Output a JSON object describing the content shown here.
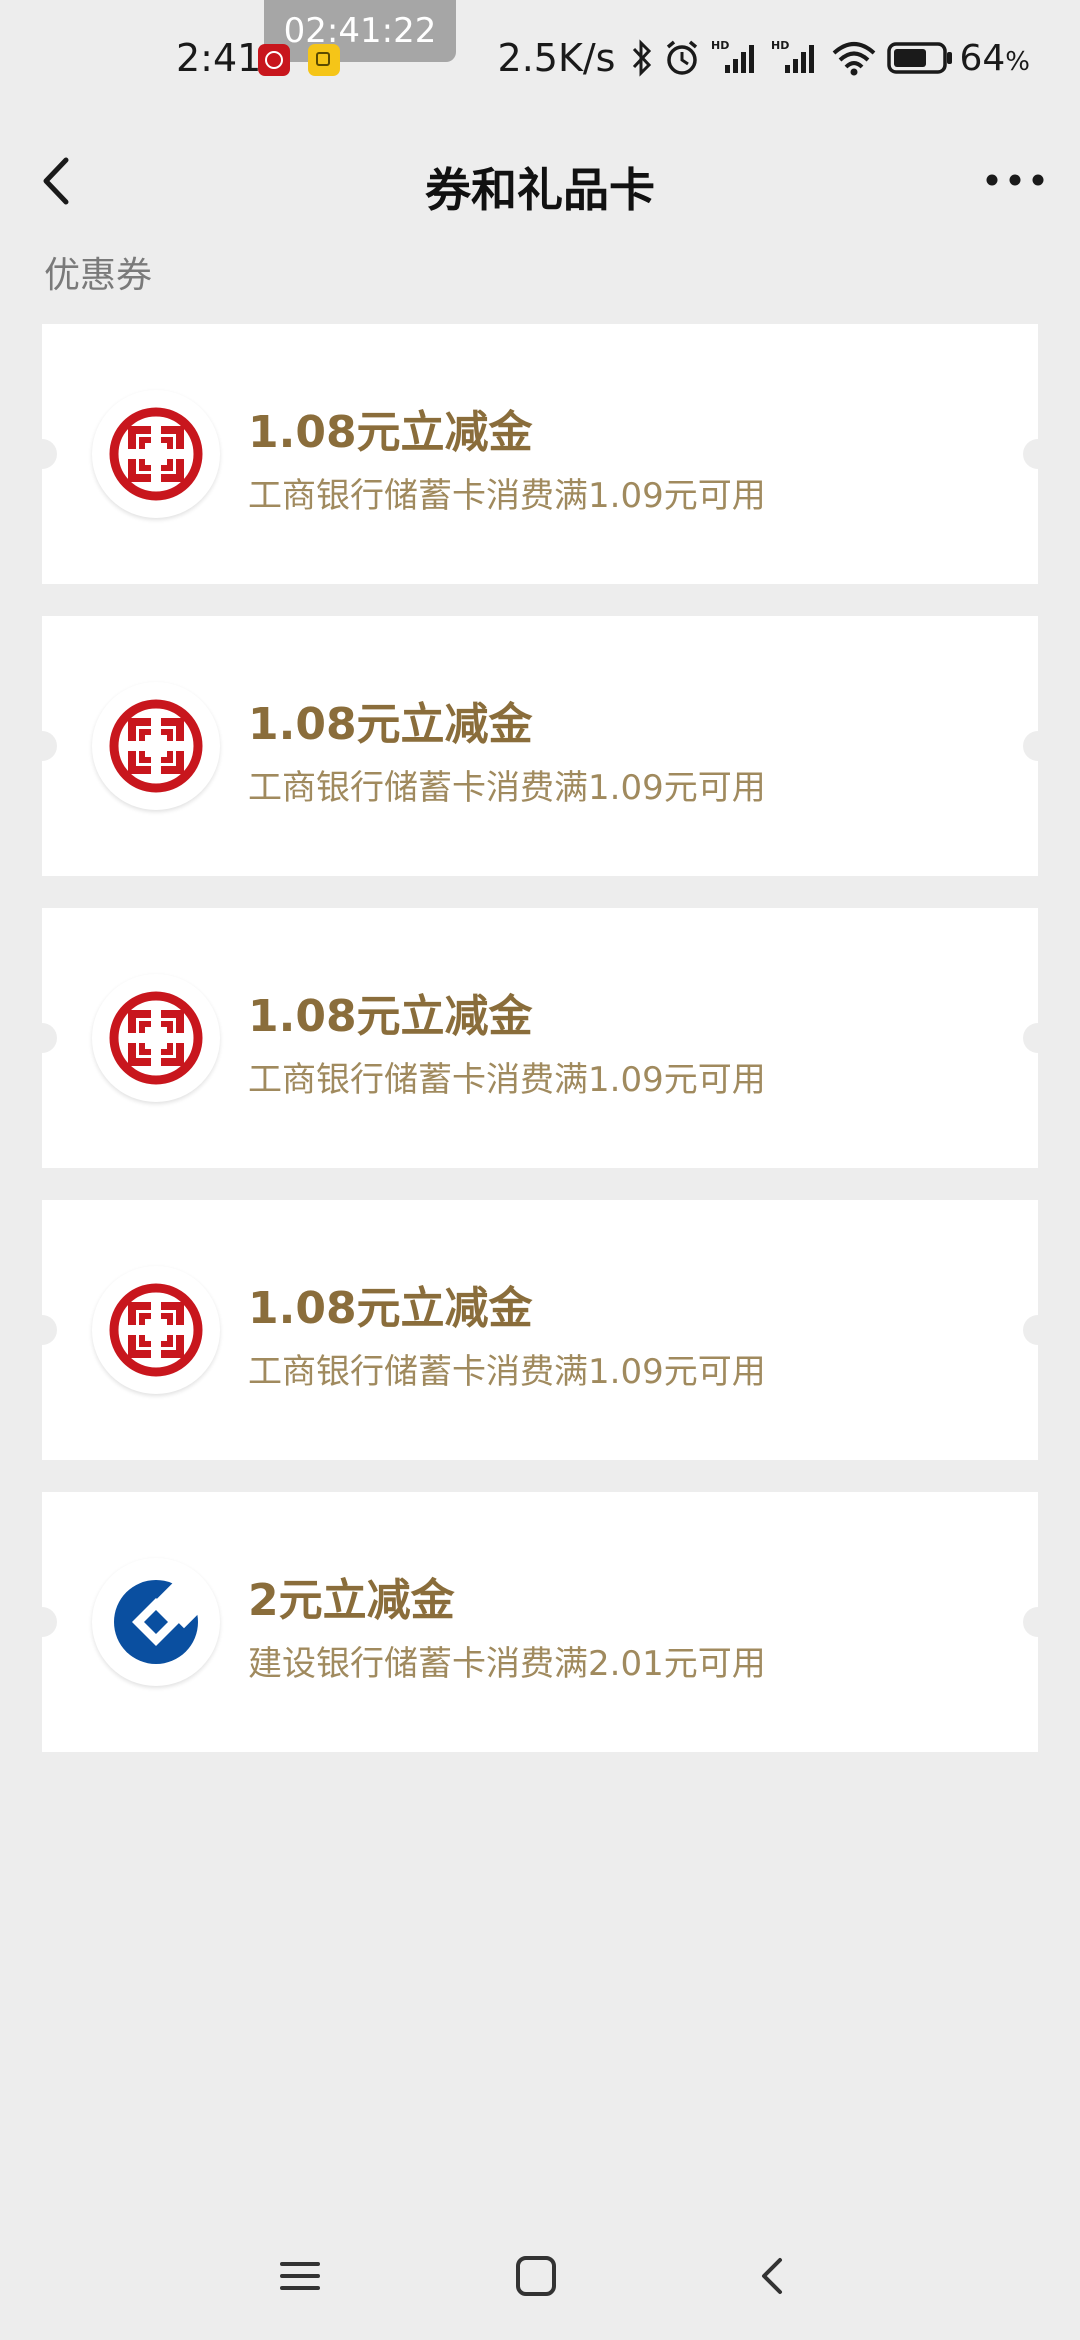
{
  "status_bar": {
    "time": "2:41",
    "clock_overlay": "02:41:22",
    "net_speed": "2.5K/s",
    "battery_percent": "64",
    "battery_suffix": "%",
    "icons": [
      "icbc-app-icon",
      "notification-icon",
      "bluetooth-icon",
      "alarm-icon",
      "hd-signal-icon",
      "hd-signal-icon",
      "wifi-icon",
      "battery-icon"
    ]
  },
  "header": {
    "title": "券和礼品卡"
  },
  "section": {
    "label": "优惠券"
  },
  "coupons": [
    {
      "bank": "icbc",
      "title": "1.08元立减金",
      "desc": "工商银行储蓄卡消费满1.09元可用"
    },
    {
      "bank": "icbc",
      "title": "1.08元立减金",
      "desc": "工商银行储蓄卡消费满1.09元可用"
    },
    {
      "bank": "icbc",
      "title": "1.08元立减金",
      "desc": "工商银行储蓄卡消费满1.09元可用"
    },
    {
      "bank": "icbc",
      "title": "1.08元立减金",
      "desc": "工商银行储蓄卡消费满1.09元可用"
    },
    {
      "bank": "ccb",
      "title": "2元立减金",
      "desc": "建设银行储蓄卡消费满2.01元可用"
    }
  ],
  "colors": {
    "icbc_red": "#c8161d",
    "ccb_blue": "#0a4fa0",
    "coupon_gold": "#8a6d3b"
  }
}
